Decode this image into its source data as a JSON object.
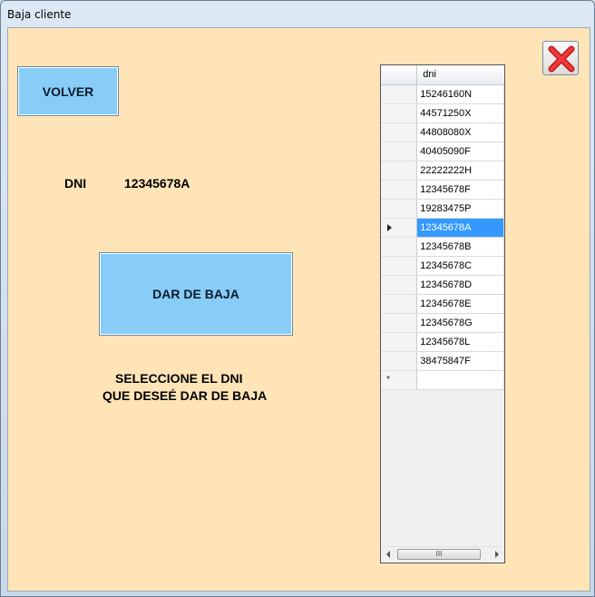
{
  "window": {
    "title": "Baja cliente"
  },
  "buttons": {
    "volver": "VOLVER",
    "dar_de_baja": "DAR DE BAJA"
  },
  "close_icon": "close-x-icon",
  "labels": {
    "dni": "DNI",
    "dni_value": "12345678A",
    "instruction_line1": "SELECCIONE EL DNI",
    "instruction_line2": "QUE DESEÉ DAR DE BAJA"
  },
  "grid": {
    "column_header": "dni",
    "rows": [
      "15246160N",
      "44571250X",
      "44808080X",
      "40405090F",
      "22222222H",
      "12345678F",
      "19283475P",
      "12345678A",
      "12345678B",
      "12345678C",
      "12345678D",
      "12345678E",
      "12345678G",
      "12345678L",
      "38475847F"
    ],
    "selected": "12345678A",
    "new_row_marker": "*",
    "scrollbar_thumb": "III"
  },
  "colors": {
    "background": "#ffe4b7",
    "button": "#87cdf8",
    "selection": "#3399ff",
    "close_x": "#e31b23"
  }
}
